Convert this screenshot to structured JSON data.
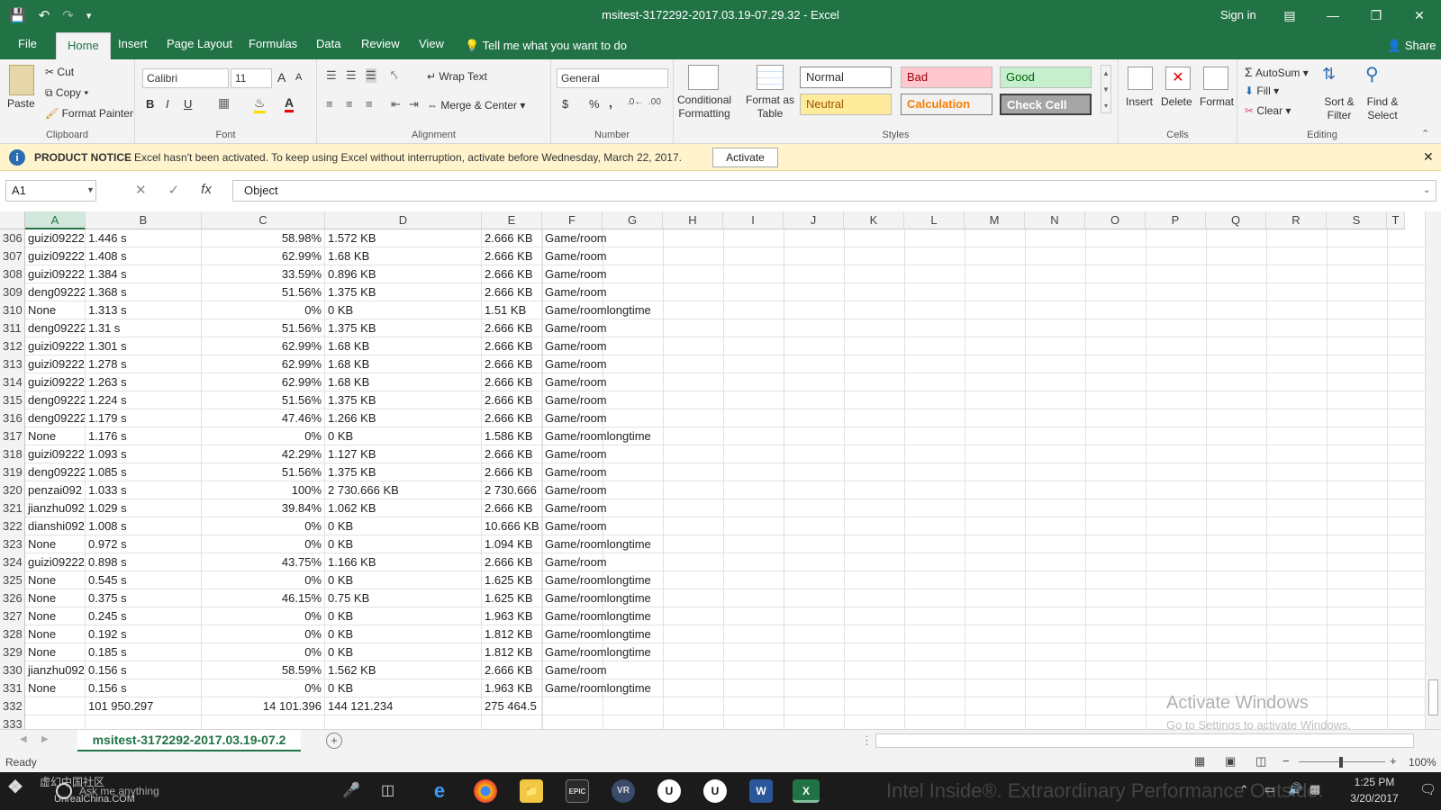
{
  "app": {
    "title": "msitest-3172292-2017.03.19-07.29.32  -  Excel",
    "signin": "Sign in",
    "share": "Share",
    "tell_me": "Tell me what you want to do"
  },
  "tabs": [
    "File",
    "Home",
    "Insert",
    "Page Layout",
    "Formulas",
    "Data",
    "Review",
    "View"
  ],
  "ribbon": {
    "clipboard": {
      "paste": "Paste",
      "cut": "Cut",
      "copy": "Copy",
      "format_painter": "Format Painter",
      "label": "Clipboard"
    },
    "font": {
      "name": "Calibri",
      "size": "11",
      "label": "Font",
      "bold": "B",
      "italic": "I",
      "underline": "U",
      "grow": "A",
      "shrink": "A",
      "color": "A"
    },
    "alignment": {
      "wrap": "Wrap Text",
      "merge": "Merge & Center",
      "label": "Alignment"
    },
    "number": {
      "format": "General",
      "currency": "$",
      "percent": "%",
      "comma": ",",
      "label": "Number"
    },
    "styles": {
      "conditional": "Conditional Formatting",
      "format_table": "Format as Table",
      "normal": "Normal",
      "bad": "Bad",
      "good": "Good",
      "neutral": "Neutral",
      "calculation": "Calculation",
      "check_cell": "Check Cell",
      "label": "Styles"
    },
    "cells": {
      "insert": "Insert",
      "delete": "Delete",
      "format": "Format",
      "label": "Cells"
    },
    "editing": {
      "autosum": "AutoSum",
      "fill": "Fill",
      "clear": "Clear",
      "sort": "Sort & Filter",
      "find": "Find & Select",
      "label": "Editing"
    }
  },
  "notice": {
    "title": "PRODUCT NOTICE",
    "text": "Excel hasn't been activated. To keep using Excel without interruption, activate before Wednesday, March 22, 2017.",
    "button": "Activate"
  },
  "formula": {
    "cell": "A1",
    "value": "Object",
    "fx": "fx"
  },
  "columns": [
    "A",
    "B",
    "C",
    "D",
    "E",
    "F",
    "G",
    "H",
    "I",
    "J",
    "K",
    "L",
    "M",
    "N",
    "O",
    "P",
    "Q",
    "R",
    "S",
    "T"
  ],
  "rows": [
    {
      "n": "306",
      "a": "guizi09222",
      "b": "1.446 s",
      "c": "58.98%",
      "d": "1.572 KB",
      "e": "2.666 KB",
      "f": "Game/room"
    },
    {
      "n": "307",
      "a": "guizi09222",
      "b": "1.408 s",
      "c": "62.99%",
      "d": "1.68 KB",
      "e": "2.666 KB",
      "f": "Game/room"
    },
    {
      "n": "308",
      "a": "guizi09222",
      "b": "1.384 s",
      "c": "33.59%",
      "d": "0.896 KB",
      "e": "2.666 KB",
      "f": "Game/room"
    },
    {
      "n": "309",
      "a": "deng09222",
      "b": "1.368 s",
      "c": "51.56%",
      "d": "1.375 KB",
      "e": "2.666 KB",
      "f": "Game/room"
    },
    {
      "n": "310",
      "a": "None",
      "b": "1.313 s",
      "c": "0%",
      "d": "0 KB",
      "e": "1.51 KB",
      "f": "Game/roomlongtime"
    },
    {
      "n": "311",
      "a": "deng09222",
      "b": "1.31 s",
      "c": "51.56%",
      "d": "1.375 KB",
      "e": "2.666 KB",
      "f": "Game/room"
    },
    {
      "n": "312",
      "a": "guizi09222",
      "b": "1.301 s",
      "c": "62.99%",
      "d": "1.68 KB",
      "e": "2.666 KB",
      "f": "Game/room"
    },
    {
      "n": "313",
      "a": "guizi09222",
      "b": "1.278 s",
      "c": "62.99%",
      "d": "1.68 KB",
      "e": "2.666 KB",
      "f": "Game/room"
    },
    {
      "n": "314",
      "a": "guizi09222",
      "b": "1.263 s",
      "c": "62.99%",
      "d": "1.68 KB",
      "e": "2.666 KB",
      "f": "Game/room"
    },
    {
      "n": "315",
      "a": "deng09222",
      "b": "1.224 s",
      "c": "51.56%",
      "d": "1.375 KB",
      "e": "2.666 KB",
      "f": "Game/room"
    },
    {
      "n": "316",
      "a": "deng09222",
      "b": "1.179 s",
      "c": "47.46%",
      "d": "1.266 KB",
      "e": "2.666 KB",
      "f": "Game/room"
    },
    {
      "n": "317",
      "a": "None",
      "b": "1.176 s",
      "c": "0%",
      "d": "0 KB",
      "e": "1.586 KB",
      "f": "Game/roomlongtime"
    },
    {
      "n": "318",
      "a": "guizi09222",
      "b": "1.093 s",
      "c": "42.29%",
      "d": "1.127 KB",
      "e": "2.666 KB",
      "f": "Game/room"
    },
    {
      "n": "319",
      "a": "deng09222",
      "b": "1.085 s",
      "c": "51.56%",
      "d": "1.375 KB",
      "e": "2.666 KB",
      "f": "Game/room"
    },
    {
      "n": "320",
      "a": "penzai092",
      "b": "1.033 s",
      "c": "100%",
      "d": "2 730.666 KB",
      "e": "2 730.666",
      "f": "Game/room"
    },
    {
      "n": "321",
      "a": "jianzhu092",
      "b": "1.029 s",
      "c": "39.84%",
      "d": "1.062 KB",
      "e": "2.666 KB",
      "f": "Game/room"
    },
    {
      "n": "322",
      "a": "dianshi092",
      "b": "1.008 s",
      "c": "0%",
      "d": "0 KB",
      "e": "10.666 KB",
      "f": "Game/room"
    },
    {
      "n": "323",
      "a": "None",
      "b": "0.972 s",
      "c": "0%",
      "d": "0 KB",
      "e": "1.094 KB",
      "f": "Game/roomlongtime"
    },
    {
      "n": "324",
      "a": "guizi09222",
      "b": "0.898 s",
      "c": "43.75%",
      "d": "1.166 KB",
      "e": "2.666 KB",
      "f": "Game/room"
    },
    {
      "n": "325",
      "a": "None",
      "b": "0.545 s",
      "c": "0%",
      "d": "0 KB",
      "e": "1.625 KB",
      "f": "Game/roomlongtime"
    },
    {
      "n": "326",
      "a": "None",
      "b": "0.375 s",
      "c": "46.15%",
      "d": "0.75 KB",
      "e": "1.625 KB",
      "f": "Game/roomlongtime"
    },
    {
      "n": "327",
      "a": "None",
      "b": "0.245 s",
      "c": "0%",
      "d": "0 KB",
      "e": "1.963 KB",
      "f": "Game/roomlongtime"
    },
    {
      "n": "328",
      "a": "None",
      "b": "0.192 s",
      "c": "0%",
      "d": "0 KB",
      "e": "1.812 KB",
      "f": "Game/roomlongtime"
    },
    {
      "n": "329",
      "a": "None",
      "b": "0.185 s",
      "c": "0%",
      "d": "0 KB",
      "e": "1.812 KB",
      "f": "Game/roomlongtime"
    },
    {
      "n": "330",
      "a": "jianzhu092",
      "b": "0.156 s",
      "c": "58.59%",
      "d": "1.562 KB",
      "e": "2.666 KB",
      "f": "Game/room"
    },
    {
      "n": "331",
      "a": "None",
      "b": "0.156 s",
      "c": "0%",
      "d": "0 KB",
      "e": "1.963 KB",
      "f": "Game/roomlongtime"
    },
    {
      "n": "332",
      "a": "",
      "b": "101 950.297",
      "c": "14 101.396",
      "d": "144 121.234",
      "e": "275 464.5",
      "f": ""
    },
    {
      "n": "333",
      "a": "",
      "b": "",
      "c": "",
      "d": "",
      "e": "",
      "f": ""
    }
  ],
  "watermark": {
    "title": "Activate Windows",
    "sub": "Go to Settings to activate Windows."
  },
  "sheet": {
    "name": "msitest-3172292-2017.03.19-07.2"
  },
  "status": {
    "ready": "Ready",
    "zoom": "100%"
  },
  "taskbar": {
    "search": "Ask me anything",
    "time": "1:25 PM",
    "date": "3/20/2017",
    "watermark_text": "虚幻中国社区",
    "watermark_site": "UnrealChina.COM",
    "bg_text": "Intel Inside®. Extraordinary Performance Outside."
  },
  "colors": {
    "accent": "#217346",
    "bad_bg": "#ffc7ce",
    "bad_fg": "#9c0006",
    "good_bg": "#c6efce",
    "good_fg": "#006100",
    "neutral_bg": "#ffeb9c",
    "neutral_fg": "#9c5700",
    "calc_bg": "#f2f2f2",
    "calc_fg": "#fa7d00",
    "check_bg": "#a5a5a5"
  }
}
